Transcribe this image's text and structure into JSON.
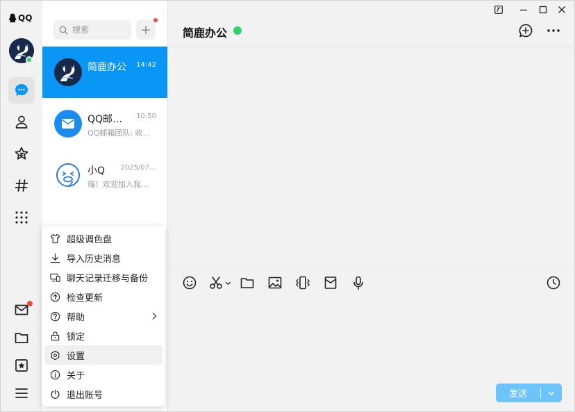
{
  "app": {
    "name": "QQ"
  },
  "search": {
    "placeholder": "搜索"
  },
  "add_label": "+",
  "chats": [
    {
      "name": "简鹿办公",
      "time": "14:42",
      "preview": ""
    },
    {
      "name": "QQ邮…",
      "time": "10:50",
      "preview": "QQ邮箱团队: 收…"
    },
    {
      "name": "小Q",
      "time": "2025/07…",
      "preview": "嗨！欢迎加入我…"
    }
  ],
  "menu": {
    "items": [
      {
        "label": "超级调色盘",
        "icon": "tshirt-icon"
      },
      {
        "label": "导入历史消息",
        "icon": "download-icon"
      },
      {
        "label": "聊天记录迁移与备份",
        "icon": "devices-icon"
      },
      {
        "label": "检查更新",
        "icon": "upgrade-icon"
      },
      {
        "label": "帮助",
        "icon": "help-icon"
      },
      {
        "label": "锁定",
        "icon": "lock-icon"
      },
      {
        "label": "设置",
        "icon": "settings-hexagon-icon"
      },
      {
        "label": "关于",
        "icon": "info-icon"
      },
      {
        "label": "退出账号",
        "icon": "power-icon"
      }
    ]
  },
  "chat": {
    "title": "简鹿办公"
  },
  "send": {
    "label": "发送"
  },
  "colors": {
    "accent": "#0a96f5",
    "online": "#2fd16a",
    "badge": "#f5493c",
    "send": "#6cc4fb"
  }
}
